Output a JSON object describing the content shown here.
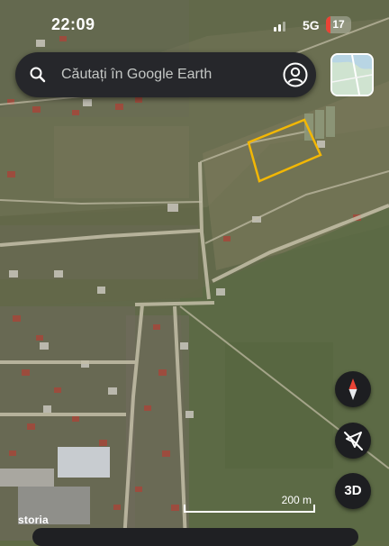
{
  "status_bar": {
    "time": "22:09",
    "network": "5G",
    "battery_level": "17",
    "battery_color": "#ea4335"
  },
  "search": {
    "placeholder": "Căutați în Google Earth",
    "search_icon": "search-icon",
    "account_icon": "account-circle-icon"
  },
  "layers": {
    "icon": "map-layers-thumbnail"
  },
  "map": {
    "highlight_color": "#f2b705",
    "scale_label": "200 m",
    "watermark": "storia"
  },
  "controls": {
    "compass_icon": "compass-icon",
    "location_icon": "location-off-icon",
    "three_d_label": "3D"
  }
}
